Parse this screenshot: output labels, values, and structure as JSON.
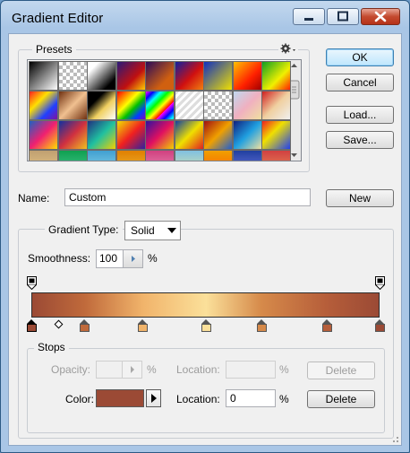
{
  "window": {
    "title": "Gradient Editor"
  },
  "presets": {
    "label": "Presets",
    "gear_icon": "gear-icon"
  },
  "buttons": {
    "ok": "OK",
    "cancel": "Cancel",
    "load": "Load...",
    "save": "Save...",
    "new": "New",
    "delete_opacity": "Delete",
    "delete_color": "Delete"
  },
  "name_field": {
    "label": "Name:",
    "value": "Custom"
  },
  "gradient_type": {
    "label": "Gradient Type:",
    "value": "Solid"
  },
  "smoothness": {
    "label": "Smoothness:",
    "value": "100",
    "unit": "%"
  },
  "stops": {
    "label": "Stops",
    "opacity_label": "Opacity:",
    "opacity_unit": "%",
    "opacity_location_label": "Location:",
    "opacity_location_unit": "%",
    "color_label": "Color:",
    "color_value": "#9b4a35",
    "color_location_label": "Location:",
    "color_location_value": "0",
    "color_location_unit": "%"
  },
  "gradient": {
    "colors": [
      "#9b4a35",
      "#c06a3b",
      "#f1b46b",
      "#fbe09a",
      "#d68a4a",
      "#b65e3a",
      "#9b4a35"
    ],
    "color_stops": [
      0,
      0.152,
      0.321,
      0.502,
      0.661,
      0.849,
      1.0
    ],
    "opacity_stops": [
      0,
      1.0
    ]
  },
  "preset_swatches": [
    [
      "linear-gradient(135deg,#000,#fff)",
      "repeating-conic-gradient(#bbb 0 25%,#fff 0 50%) 0 0/8px 8px",
      "linear-gradient(135deg,#fff 20%,#000 80%)",
      "linear-gradient(135deg,#2a1a7a,#c01010 60%,#ffcc00)",
      "linear-gradient(135deg,#2a0a5a,#d06010 70%)",
      "linear-gradient(135deg,#1020a0,#d01010 55%,#f08010)",
      "linear-gradient(135deg,#1030c0,#f0e000)",
      "linear-gradient(135deg,#ffc000,#ff2000 60%,#a00000)",
      "linear-gradient(135deg,#10a020,#f0f000 60%,#ff2000)"
    ],
    [
      "linear-gradient(135deg,#ff2020,#ffe000 35%,#2040ff 70%,#8010a0)",
      "linear-gradient(135deg,#703010,#f0c090 50%,#703010)",
      "linear-gradient(135deg,#000 30%,#f0d060 60%,#fff)",
      "linear-gradient(135deg,#ff0000,#ff8000,#ffff00,#00c000,#0040ff,#8000c0)",
      "repeating-linear-gradient(135deg,#f0f,#00f 6px,#0ff 12px,#0f0 18px,#ff0 24px,#f00 30px)",
      "repeating-linear-gradient(135deg,#ddd 0 3px,#fff 3px 6px)",
      "repeating-conic-gradient(#bbb 0 25%,#fff 0 50%) 0 0/8px 8px",
      "linear-gradient(135deg,#c0d8f0,#f0b0c0 50%,#f0e0a0)",
      "linear-gradient(135deg,#d02020,#f0d0a0 50%,#f0f0f0)"
    ],
    [
      "linear-gradient(135deg,#2060c0,#f02070 50%,#ffe000)",
      "linear-gradient(135deg,#1030a0,#d03040 50%,#f0c020)",
      "linear-gradient(135deg,#203080,#20c0a0 50%,#f0d000)",
      "linear-gradient(135deg,#f0e000,#f02020 50%,#3020a0)",
      "linear-gradient(135deg,#3010a0,#e01060 50%,#f0d000)",
      "linear-gradient(135deg,#1040a0,#f0e000 50%,#e02020)",
      "linear-gradient(135deg,#a01010,#f0a000 50%,#2060d0)",
      "linear-gradient(135deg,#102080,#20a0e0 50%,#f0e0a0)",
      "linear-gradient(135deg,#f02020,#f0e000 40%,#2040f0)"
    ],
    [
      "linear-gradient(#c0a070,#f0d090)",
      "linear-gradient(#10a050,#50d0a0)",
      "linear-gradient(#40a0d0,#a0e0f0)",
      "linear-gradient(#e08000,#f0c040)",
      "linear-gradient(#d04080,#f0a0c0)",
      "linear-gradient(#80c0e0,#f0f0a0)",
      "linear-gradient(#f0a000,#ff5000)",
      "linear-gradient(#2040a0,#8080f0)",
      "linear-gradient(#d04040,#f0a060)"
    ]
  ]
}
